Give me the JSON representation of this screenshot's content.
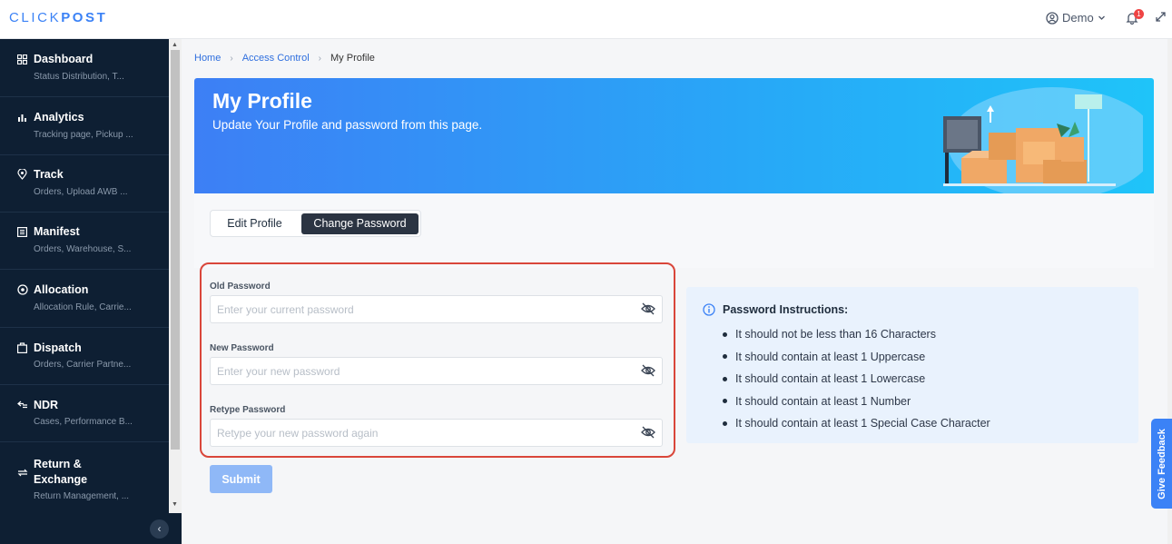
{
  "header": {
    "logo_light": "CLICK",
    "logo_bold": "POST",
    "user": "Demo",
    "notification_count": "1"
  },
  "sidebar": {
    "items": [
      {
        "label": "Dashboard",
        "sub": "Status Distribution, T...",
        "icon": "grid-icon"
      },
      {
        "label": "Analytics",
        "sub": "Tracking page, Pickup ...",
        "icon": "bar-chart-icon"
      },
      {
        "label": "Track",
        "sub": "Orders, Upload AWB ...",
        "icon": "location-pin-icon"
      },
      {
        "label": "Manifest",
        "sub": "Orders, Warehouse, S...",
        "icon": "document-list-icon"
      },
      {
        "label": "Allocation",
        "sub": "Allocation Rule, Carrie...",
        "icon": "target-icon"
      },
      {
        "label": "Dispatch",
        "sub": "Orders, Carrier Partne...",
        "icon": "package-icon"
      },
      {
        "label": "NDR",
        "sub": "Cases, Performance B...",
        "icon": "undo-list-icon"
      },
      {
        "label": "Return &\nExchange",
        "sub": "Return Management, ...",
        "icon": "exchange-icon"
      }
    ]
  },
  "breadcrumb": {
    "home": "Home",
    "access_control": "Access Control",
    "current": "My Profile"
  },
  "banner": {
    "title": "My Profile",
    "subtitle": "Update Your Profile and password from this page."
  },
  "tabs": {
    "edit": "Edit Profile",
    "change": "Change Password"
  },
  "form": {
    "old_label": "Old Password",
    "old_placeholder": "Enter your current password",
    "new_label": "New Password",
    "new_placeholder": "Enter your new password",
    "retype_label": "Retype Password",
    "retype_placeholder": "Retype your new password again",
    "submit": "Submit"
  },
  "instructions": {
    "title": "Password Instructions:",
    "items": [
      "It should not be less than 16 Characters",
      "It should contain at least 1 Uppercase",
      "It should contain at least 1 Lowercase",
      "It should contain at least 1 Number",
      "It should contain at least 1 Special Case Character"
    ]
  },
  "feedback": "Give Feedback",
  "colors": {
    "accent": "#3b82f6",
    "sidebar_bg": "#0e1f33",
    "highlight_border": "#d9463a"
  }
}
